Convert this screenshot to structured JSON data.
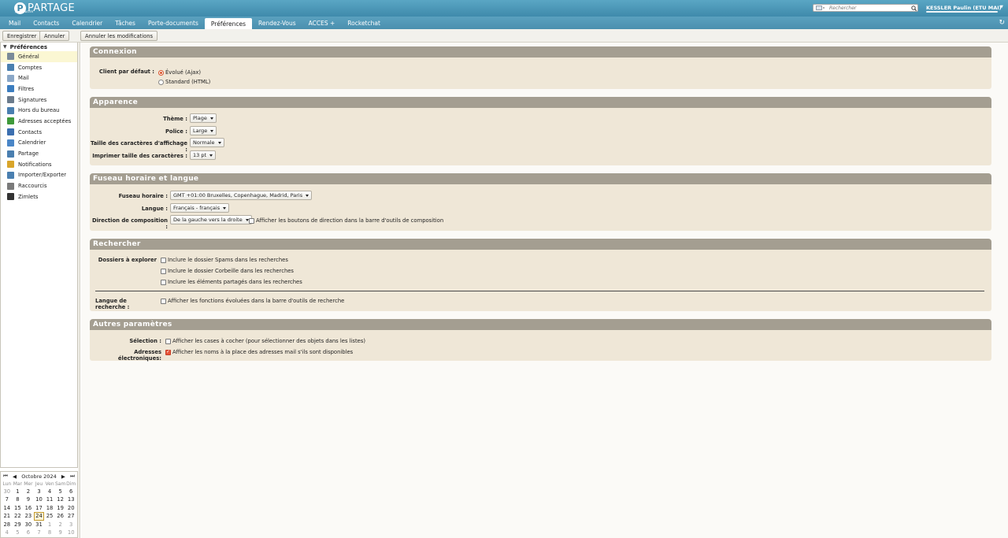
{
  "brand": {
    "name": "PARTAGE",
    "sub": "par RENATER",
    "mark": "P"
  },
  "search": {
    "placeholder": "Rechercher"
  },
  "user": {
    "name": "KESSLER Paulin (ETU MAI)"
  },
  "app_tabs": [
    "Mail",
    "Contacts",
    "Calendrier",
    "Tâches",
    "Porte-documents",
    "Préférences",
    "Rendez-Vous",
    "ACCES +",
    "Rocketchat"
  ],
  "active_tab": "Préférences",
  "toolbar": {
    "save": "Enregistrer",
    "cancel": "Annuler",
    "undo": "Annuler les modifications"
  },
  "sidebar": {
    "title": "Préférences",
    "items": [
      {
        "label": "Général",
        "icon": "gear-icon",
        "color": "#7a8a99"
      },
      {
        "label": "Comptes",
        "icon": "accounts-icon",
        "color": "#4a7fb0"
      },
      {
        "label": "Mail",
        "icon": "mail-icon",
        "color": "#8aa7c7"
      },
      {
        "label": "Filtres",
        "icon": "filter-icon",
        "color": "#3b7dbf"
      },
      {
        "label": "Signatures",
        "icon": "signature-icon",
        "color": "#6b7b8c"
      },
      {
        "label": "Hors du bureau",
        "icon": "out-of-office-icon",
        "color": "#4a7fb0"
      },
      {
        "label": "Adresses acceptées",
        "icon": "shield-icon",
        "color": "#3f9a3a"
      },
      {
        "label": "Contacts",
        "icon": "contacts-icon",
        "color": "#3b6fb0"
      },
      {
        "label": "Calendrier",
        "icon": "calendar-icon",
        "color": "#4a86c7"
      },
      {
        "label": "Partage",
        "icon": "share-icon",
        "color": "#4a7fb0"
      },
      {
        "label": "Notifications",
        "icon": "bell-icon",
        "color": "#d9a52a"
      },
      {
        "label": "Importer/Exporter",
        "icon": "import-export-icon",
        "color": "#4a7fb0"
      },
      {
        "label": "Raccourcis",
        "icon": "shortcuts-icon",
        "color": "#7a7a7a"
      },
      {
        "label": "Zimlets",
        "icon": "zimlet-icon",
        "color": "#333333"
      }
    ]
  },
  "calendar": {
    "month": "Octobre 2024",
    "dow": [
      "Lun",
      "Mar",
      "Mer",
      "Jeu",
      "Ven",
      "Sam",
      "Dim"
    ],
    "days": [
      [
        "30",
        "1",
        "2",
        "3",
        "4",
        "5",
        "6"
      ],
      [
        "7",
        "8",
        "9",
        "10",
        "11",
        "12",
        "13"
      ],
      [
        "14",
        "15",
        "16",
        "17",
        "18",
        "19",
        "20"
      ],
      [
        "21",
        "22",
        "23",
        "24",
        "25",
        "26",
        "27"
      ],
      [
        "28",
        "29",
        "30",
        "31",
        "1",
        "2",
        "3"
      ],
      [
        "4",
        "5",
        "6",
        "7",
        "8",
        "9",
        "10"
      ]
    ],
    "today": "24"
  },
  "sections": {
    "connexion": {
      "title": "Connexion",
      "client_label": "Client par défaut :",
      "opt_ajax": "Évolué (Ajax)",
      "opt_html": "Standard (HTML)"
    },
    "apparence": {
      "title": "Apparence",
      "theme_label": "Thème :",
      "theme_value": "Plage",
      "police_label": "Police :",
      "police_value": "Large",
      "taille_label": "Taille des caractères d'affichage :",
      "taille_value": "Normale",
      "print_label": "Imprimer taille des caractères :",
      "print_value": "13 pt"
    },
    "fuseau": {
      "title": "Fuseau horaire et langue",
      "tz_label": "Fuseau horaire :",
      "tz_value": "GMT +01:00 Bruxelles, Copenhague, Madrid, Paris",
      "lang_label": "Langue :",
      "lang_value": "Français - français",
      "dir_label": "Direction de composition :",
      "dir_value": "De la gauche vers la droite",
      "dir_check": "Afficher les boutons de direction dans la barre d'outils de composition"
    },
    "rechercher": {
      "title": "Rechercher",
      "folders_label": "Dossiers à explorer",
      "spam": "Inclure le dossier Spams dans les recherches",
      "trash": "Inclure le dossier Corbeille dans les recherches",
      "shared": "Inclure les éléments partagés dans les recherches",
      "lang_label": "Langue de recherche :",
      "lang_check": "Afficher les fonctions évoluées dans la barre d'outils de recherche"
    },
    "autres": {
      "title": "Autres paramètres",
      "sel_label": "Sélection :",
      "sel_check": "Afficher les cases à cocher (pour sélectionner des objets dans les listes)",
      "addr_label": "Adresses électroniques:",
      "addr_check": "Afficher les noms à la place des adresses mail s'ils sont disponibles"
    }
  }
}
